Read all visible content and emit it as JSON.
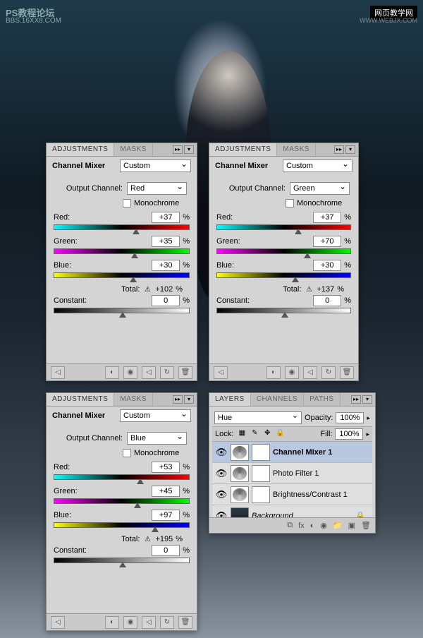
{
  "watermarks": {
    "tl1": "PS教程论坛",
    "tl2": "BBS.16XX8.COM",
    "tr1": "网页教学网",
    "tr2": "WWW.WEBJX.COM"
  },
  "common": {
    "tab_adjustments": "ADJUSTMENTS",
    "tab_masks": "MASKS",
    "title": "Channel Mixer",
    "preset": "Custom",
    "output_label": "Output Channel:",
    "mono": "Monochrome",
    "red_label": "Red:",
    "green_label": "Green:",
    "blue_label": "Blue:",
    "total_label": "Total:",
    "constant_label": "Constant:",
    "pct": "%"
  },
  "p1": {
    "output": "Red",
    "red": "+37",
    "green": "+35",
    "blue": "+30",
    "total": "+102",
    "constant": "0"
  },
  "p2": {
    "output": "Green",
    "red": "+37",
    "green": "+70",
    "blue": "+30",
    "total": "+137",
    "constant": "0"
  },
  "p3": {
    "output": "Blue",
    "red": "+53",
    "green": "+45",
    "blue": "+97",
    "total": "+195",
    "constant": "0"
  },
  "layers": {
    "tab_layers": "LAYERS",
    "tab_channels": "CHANNELS",
    "tab_paths": "PATHS",
    "blend": "Hue",
    "opacity_label": "Opacity:",
    "opacity": "100%",
    "lock_label": "Lock:",
    "fill_label": "Fill:",
    "fill": "100%",
    "items": [
      {
        "name": "Channel Mixer 1",
        "bold": true
      },
      {
        "name": "Photo Filter 1"
      },
      {
        "name": "Brightness/Contrast 1"
      },
      {
        "name": "Background",
        "italic": true,
        "locked": true
      }
    ]
  }
}
